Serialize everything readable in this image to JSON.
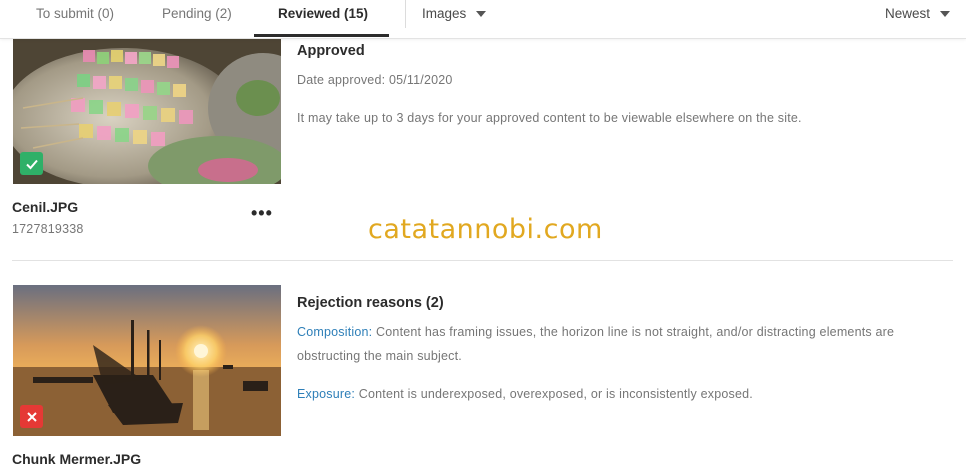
{
  "tabs": [
    {
      "label": "To submit (0)",
      "active": false
    },
    {
      "label": "Pending (2)",
      "active": false
    },
    {
      "label": "Reviewed (15)",
      "active": true
    }
  ],
  "filters": {
    "type": "Images",
    "sort": "Newest"
  },
  "items": [
    {
      "filename": "Cenil.JPG",
      "id": "1727819338",
      "status": "approved",
      "status_icon": "check-icon",
      "heading": "Approved",
      "date_line": "Date approved: 05/11/2020",
      "note": "It may take up to 3 days for your approved content to be viewable elsewhere on the site."
    },
    {
      "filename": "Chunk Mermer.JPG",
      "status": "rejected",
      "status_icon": "x-icon",
      "heading": "Rejection reasons (2)",
      "reasons": [
        {
          "key": "Composition:",
          "text": " Content has framing issues, the horizon line is not straight, and/or distracting elements are obstructing the main subject."
        },
        {
          "key": "Exposure:",
          "text": " Content is underexposed, overexposed, or is inconsistently exposed."
        }
      ]
    }
  ],
  "more_icon": "more-horizontal-icon",
  "watermark": "catatannobi.com",
  "colors": {
    "approved": "#2fb068",
    "rejected": "#e53935",
    "link": "#2e7fb8"
  }
}
